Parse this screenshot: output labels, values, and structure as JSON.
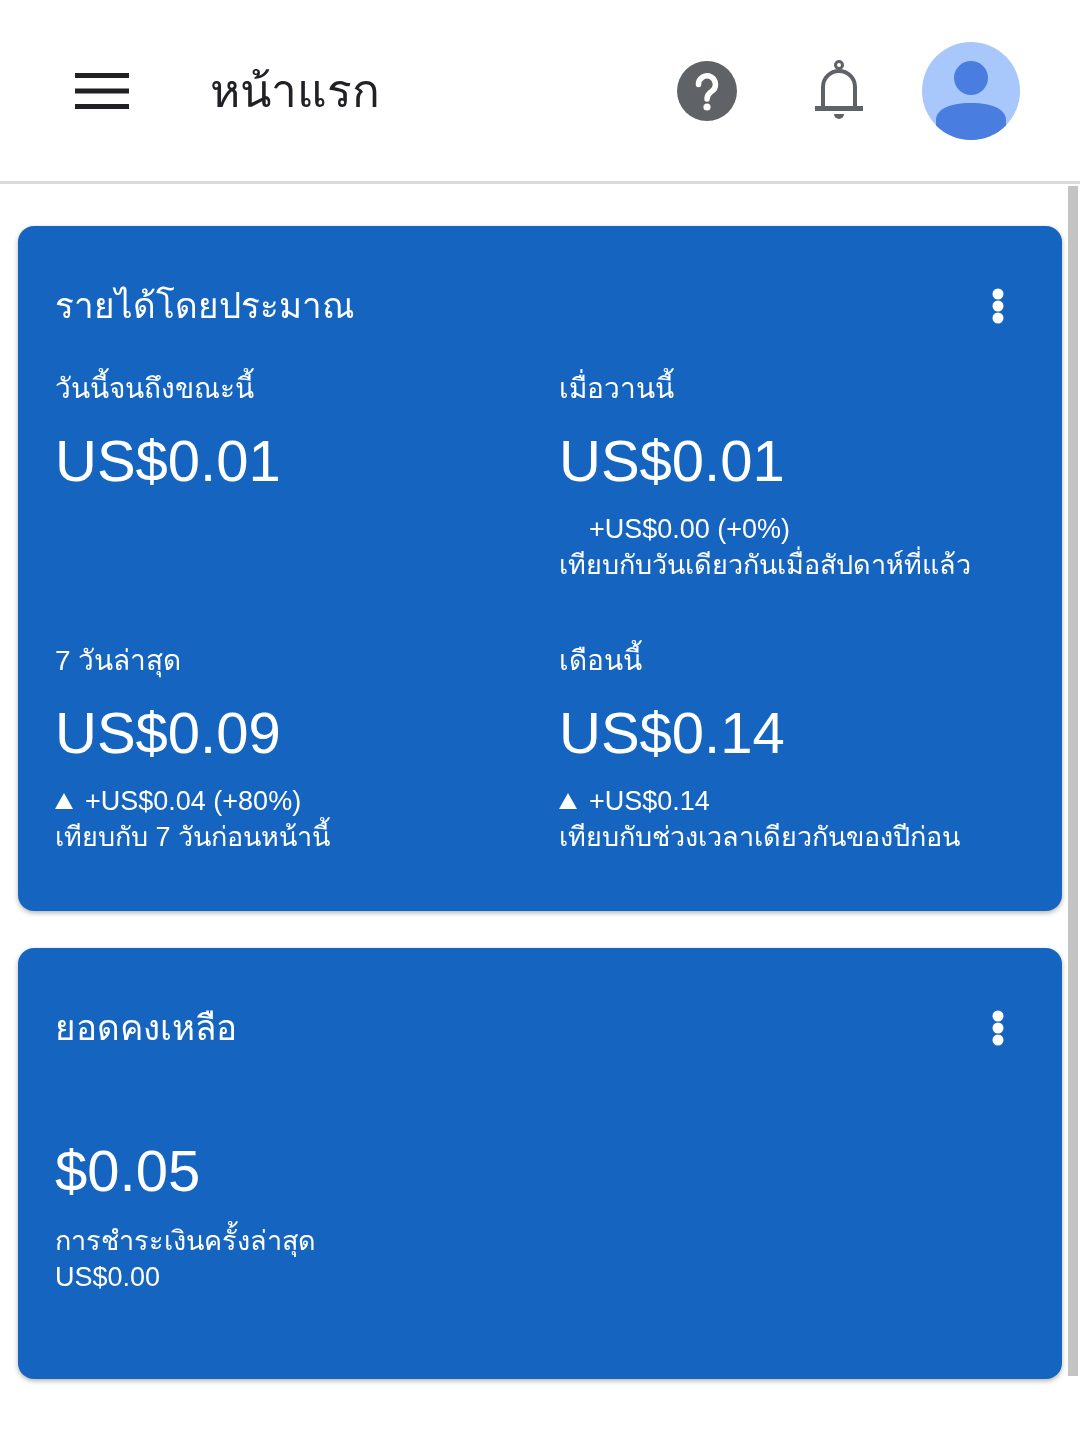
{
  "top_bar": {
    "title": "หน้าแรก"
  },
  "cards": [
    {
      "kind": "metrics",
      "title": "รายได้โดยประมาณ",
      "metrics": [
        {
          "label": "วันนี้จนถึงขณะนี้",
          "value": "US$0.01"
        },
        {
          "label": "เมื่อวานนี้",
          "value": "US$0.01",
          "rising": false,
          "change": "+US$0.00 (+0%)",
          "comparison": "เทียบกับวันเดียวกันเมื่อสัปดาห์ที่แล้ว"
        },
        {
          "label": "7 วันล่าสุด",
          "value": "US$0.09",
          "rising": true,
          "change": "+US$0.04 (+80%)",
          "comparison": "เทียบกับ 7 วันก่อนหน้านี้"
        },
        {
          "label": "เดือนนี้",
          "value": "US$0.14",
          "rising": true,
          "change": "+US$0.14",
          "comparison": "เทียบกับช่วงเวลาเดียวกันของปีก่อน"
        }
      ]
    },
    {
      "kind": "balance",
      "title": "ยอดคงเหลือ",
      "value": "$0.05",
      "note": "การชำระเงินครั้งล่าสุด",
      "note_value": "US$0.00"
    }
  ]
}
